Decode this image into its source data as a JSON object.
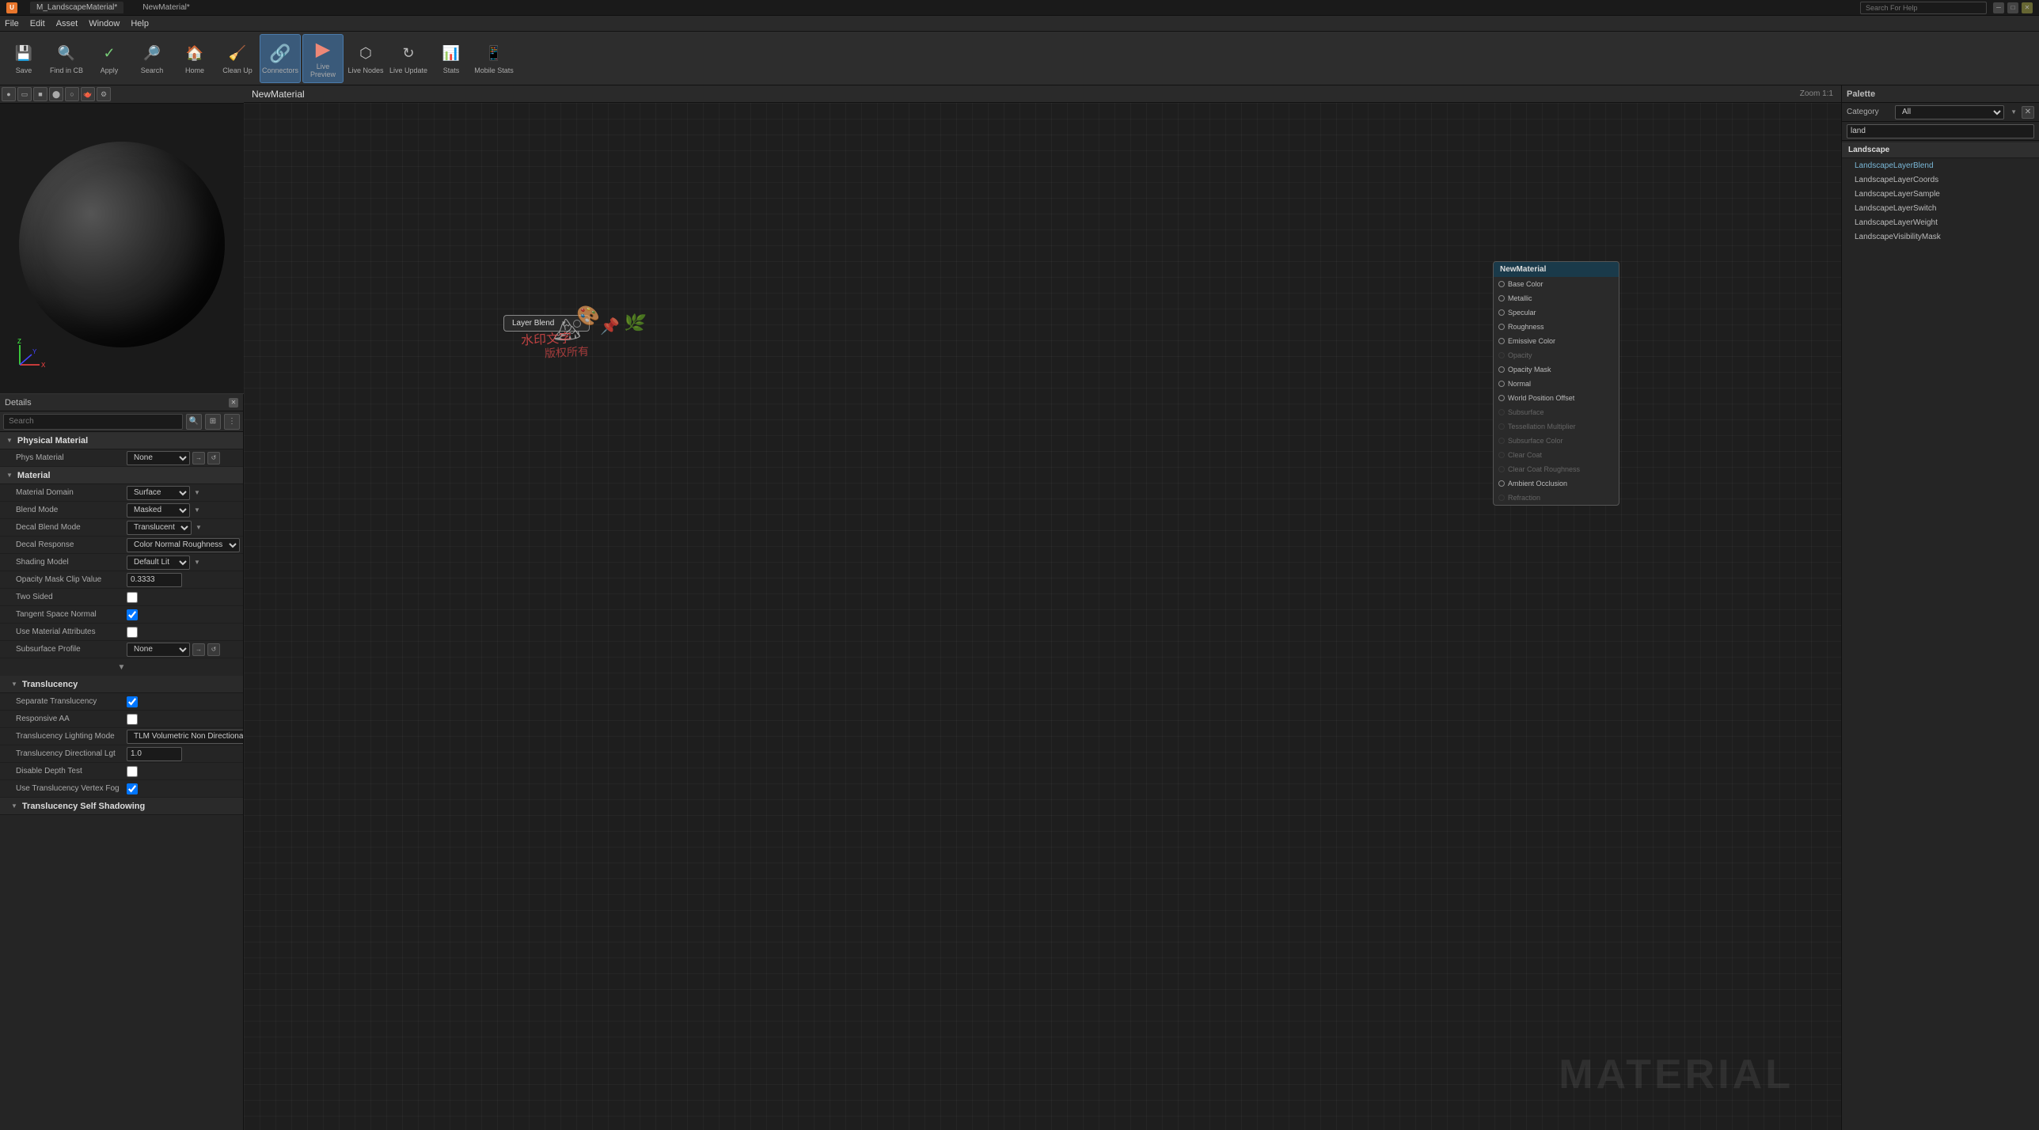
{
  "window": {
    "title1": "M_LandscapeMaterial*",
    "title2": "NewMaterial*",
    "search_placeholder": "Search For Help"
  },
  "menu": {
    "items": [
      "File",
      "Edit",
      "Asset",
      "Window",
      "Help"
    ]
  },
  "toolbar": {
    "buttons": [
      {
        "id": "save",
        "label": "Save",
        "icon": "💾"
      },
      {
        "id": "find-in-cb",
        "label": "Find in CB",
        "icon": "🔍"
      },
      {
        "id": "apply",
        "label": "Apply",
        "icon": "✓"
      },
      {
        "id": "search",
        "label": "Search",
        "icon": "🔎"
      },
      {
        "id": "home",
        "label": "Home",
        "icon": "🏠"
      },
      {
        "id": "clean-up",
        "label": "Clean Up",
        "icon": "🧹"
      },
      {
        "id": "connectors",
        "label": "Connectors",
        "icon": "🔗",
        "active": true
      },
      {
        "id": "live-preview",
        "label": "Live Preview",
        "icon": "▶",
        "active": true
      },
      {
        "id": "live-nodes",
        "label": "Live Nodes",
        "icon": "⬡"
      },
      {
        "id": "live-update",
        "label": "Live Update",
        "icon": "↻"
      },
      {
        "id": "stats",
        "label": "Stats",
        "icon": "📊"
      },
      {
        "id": "mobile-stats",
        "label": "Mobile Stats",
        "icon": "📱"
      }
    ]
  },
  "canvas": {
    "title": "NewMaterial",
    "zoom": "Zoom 1:1"
  },
  "material_node": {
    "title": "NewMaterial",
    "pins": [
      {
        "label": "Base Color",
        "connected": false
      },
      {
        "label": "Metallic",
        "connected": false
      },
      {
        "label": "Specular",
        "connected": false
      },
      {
        "label": "Roughness",
        "connected": false
      },
      {
        "label": "Emissive Color",
        "connected": false
      },
      {
        "label": "Opacity",
        "connected": false,
        "disabled": true
      },
      {
        "label": "Opacity Mask",
        "connected": false
      },
      {
        "label": "Normal",
        "connected": false
      },
      {
        "label": "World Position Offset",
        "connected": false
      },
      {
        "label": "Subsurface",
        "connected": false,
        "disabled": true
      },
      {
        "label": "Tessellation Multiplier",
        "connected": false,
        "disabled": true
      },
      {
        "label": "Subsurface Color",
        "connected": false,
        "disabled": true
      },
      {
        "label": "Clear Coat",
        "connected": false,
        "disabled": true
      },
      {
        "label": "Clear Coat Roughness",
        "connected": false,
        "disabled": true
      },
      {
        "label": "Ambient Occlusion",
        "connected": false
      },
      {
        "label": "Refraction",
        "connected": false,
        "disabled": true
      }
    ]
  },
  "layer_blend_node": {
    "label": "Layer Blend"
  },
  "watermark": "MATERIAL",
  "details": {
    "title": "Details",
    "search_placeholder": "Search"
  },
  "physical_material": {
    "section_title": "Physical Material",
    "phys_material_label": "Phys Material",
    "phys_material_value": "None"
  },
  "material_section": {
    "section_title": "Material",
    "properties": [
      {
        "label": "Material Domain",
        "type": "dropdown",
        "value": "Surface"
      },
      {
        "label": "Blend Mode",
        "type": "dropdown",
        "value": "Masked"
      },
      {
        "label": "Decal Blend Mode",
        "type": "dropdown",
        "value": "Translucent"
      },
      {
        "label": "Decal Response",
        "type": "dropdown",
        "value": "Color Normal Roughness"
      },
      {
        "label": "Shading Model",
        "type": "dropdown",
        "value": "Default Lit"
      },
      {
        "label": "Opacity Mask Clip Value",
        "type": "input",
        "value": "0.3333"
      },
      {
        "label": "Two Sided",
        "type": "checkbox",
        "value": false
      },
      {
        "label": "Tangent Space Normal",
        "type": "checkbox",
        "value": true
      },
      {
        "label": "Use Material Attributes",
        "type": "checkbox",
        "value": false
      },
      {
        "label": "Subsurface Profile",
        "type": "dropdown",
        "value": "None"
      }
    ]
  },
  "translucency_section": {
    "section_title": "Translucency",
    "properties": [
      {
        "label": "Separate Translucency",
        "type": "checkbox",
        "value": true
      },
      {
        "label": "Responsive AA",
        "type": "checkbox",
        "value": false
      },
      {
        "label": "Translucency Lighting Mode",
        "type": "dropdown",
        "value": "TLM Volumetric Non Directional"
      },
      {
        "label": "Translucency Directional Lgt",
        "type": "input",
        "value": "1.0"
      },
      {
        "label": "Disable Depth Test",
        "type": "checkbox",
        "value": false
      },
      {
        "label": "Use Translucency Vertex Fog",
        "type": "checkbox",
        "value": true
      }
    ]
  },
  "self_shadowing_section": {
    "section_title": "Translucency Self Shadowing"
  },
  "palette": {
    "title": "Palette",
    "category_label": "Category",
    "category_value": "All",
    "search_placeholder": "land",
    "section": "Landscape",
    "items": [
      "LandscapeLayerBlend",
      "LandscapeLayerCoords",
      "LandscapeLayerSample",
      "LandscapeLayerSwitch",
      "LandscapeLayerWeight",
      "LandscapeVisibilityMask"
    ]
  },
  "preview_buttons": [
    "sphere",
    "plane",
    "cube",
    "cylinder",
    "torus",
    "teapot",
    "settings"
  ],
  "colors": {
    "active_tab": "#3a5a7a",
    "node_header": "#1a3a4a",
    "section_bg": "#2f2f2f",
    "panel_bg": "#252525",
    "canvas_bg": "#1e1e1e"
  }
}
